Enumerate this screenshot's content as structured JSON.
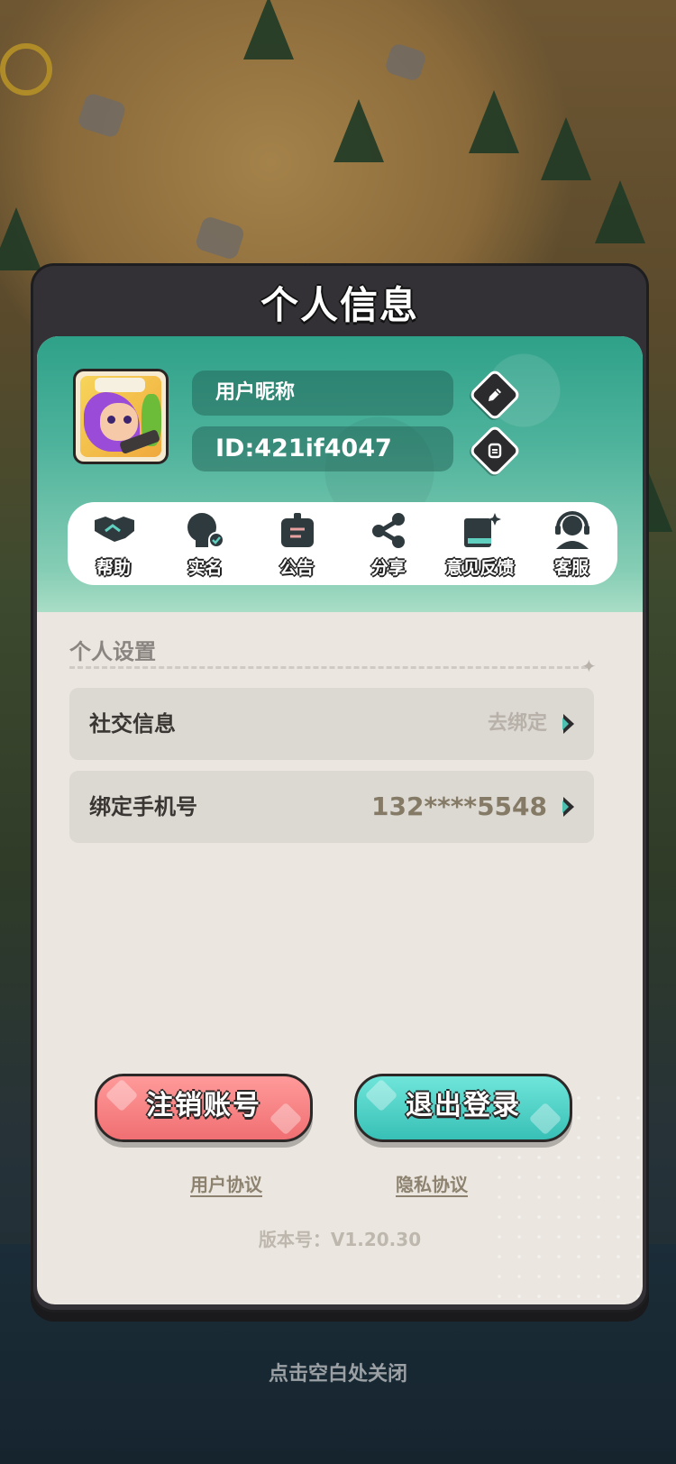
{
  "modal": {
    "title": "个人信息"
  },
  "profile": {
    "nickname": "用户昵称",
    "id_text": "ID:421if4047",
    "avatar_icon": "character-avatar",
    "edit_icon": "pencil-icon",
    "copy_icon": "copy-icon"
  },
  "toolbar": {
    "items": [
      {
        "label": "帮助",
        "icon": "handshake-icon"
      },
      {
        "label": "实名",
        "icon": "verified-user-icon"
      },
      {
        "label": "公告",
        "icon": "notice-board-icon"
      },
      {
        "label": "分享",
        "icon": "share-icon"
      },
      {
        "label": "意见反馈",
        "icon": "feedback-book-icon"
      },
      {
        "label": "客服",
        "icon": "headset-icon"
      }
    ]
  },
  "settings": {
    "section_title": "个人设置",
    "rows": [
      {
        "label": "社交信息",
        "value": "去绑定"
      },
      {
        "label": "绑定手机号",
        "value": "132****5548"
      }
    ]
  },
  "actions": {
    "cancel_account": "注销账号",
    "logout": "退出登录"
  },
  "links": {
    "user_agreement": "用户协议",
    "privacy_policy": "隐私协议"
  },
  "version_text": "版本号：V1.20.30",
  "close_hint": "点击空白处关闭",
  "colors": {
    "teal_header": "#2fa189",
    "panel_bg": "#ebe7e0",
    "cancel_button": "#f06f72",
    "logout_button": "#38c0b6",
    "modal_frame": "#333135"
  }
}
